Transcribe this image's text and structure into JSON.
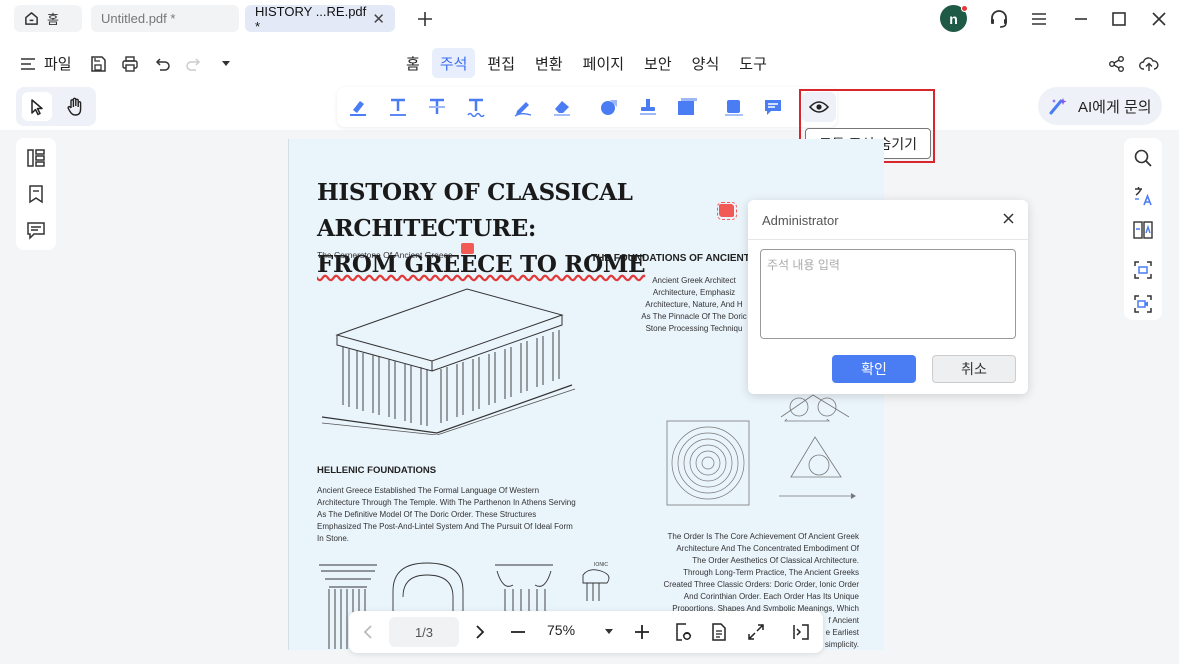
{
  "tabs": {
    "home_label": "홈",
    "doc1_label": "Untitled.pdf *",
    "doc2_label": "HISTORY ...RE.pdf *"
  },
  "user": {
    "avatar_letter": "n"
  },
  "toolbar": {
    "file_label": "파일"
  },
  "menus": [
    "홈",
    "주석",
    "편집",
    "변환",
    "페이지",
    "보안",
    "양식",
    "도구"
  ],
  "active_menu": "주석",
  "tooltip": {
    "hide_all_annotations": "모든 주석 숨기기"
  },
  "ai": {
    "label": "AI에게 문의"
  },
  "document": {
    "title_line1": "HISTORY OF CLASSICAL  ARCHITECTURE:",
    "title_line2": "FROM GREECE TO ROME",
    "subtitle": "The Cornerstone Of Ancient Greece",
    "foundations_heading": "THE FOUNDATIONS OF ANCIENT",
    "foundations_text": "Ancient Greek Architect\nArchitecture, Emphasiz\nArchitecture, Nature, And H\nAs The Pinnacle Of The Doric\nStone Processing Techniqu",
    "hellenic_heading": "HELLENIC FOUNDATIONS",
    "hellenic_text": "Ancient Greece Established The Formal Language Of Western\nArchitecture Through The Temple. With The Parthenon In Athens Serving\nAs The Definitive Model Of The Doric Order. These Structures\nEmphasized The Post-And-Lintel System And The Pursuit Of Ideal Form\nIn Stone.",
    "order_text": "The Order Is The Core Achievement Of Ancient Greek\nArchitecture And The Concentrated Embodiment Of\nThe Order Aesthetics Of Classical Architecture.\nThrough Long-Term Practice, The Ancient Greeks\nCreated Three Classic Orders: Doric Order, Ionic Order\nAnd Corinthian Order. Each Order Has Its Unique\nProportions, Shapes And Symbolic Meanings, Which\nf Ancient\ne Earliest\nsimplicity.",
    "ionic_label": "IONIC"
  },
  "comment": {
    "author": "Administrator",
    "placeholder": "주석 내용 입력",
    "ok_label": "확인",
    "cancel_label": "취소"
  },
  "pager": {
    "page_indicator": "1/3",
    "zoom_label": "75%"
  },
  "colors": {
    "accent": "#3a6df0",
    "highlight_border": "#d9252c",
    "avatar_bg": "#1e5a45",
    "annotation_icon": "#f25a55",
    "page_bg": "#eaf4fb"
  }
}
